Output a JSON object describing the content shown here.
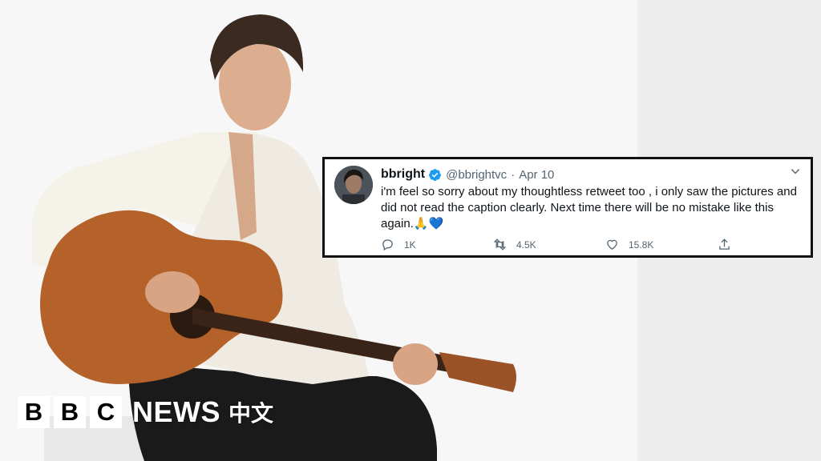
{
  "tweet": {
    "name": "bbright",
    "handle": "@bbrightvc",
    "separator": "·",
    "date": "Apr 10",
    "text": "i'm feel so sorry about my thoughtless retweet too , i only saw the pictures and did not read the caption clearly. Next time there will be no mistake like this again.🙏💙",
    "replies": "1K",
    "retweets": "4.5K",
    "likes": "15.8K",
    "verified_color": "#1d9bf0"
  },
  "logo": {
    "letters": [
      "B",
      "B",
      "C"
    ],
    "news": "NEWS",
    "chinese": "中文"
  },
  "icons": [
    "verified-badge-icon",
    "chevron-down-icon",
    "reply-icon",
    "retweet-icon",
    "like-icon",
    "share-icon"
  ]
}
